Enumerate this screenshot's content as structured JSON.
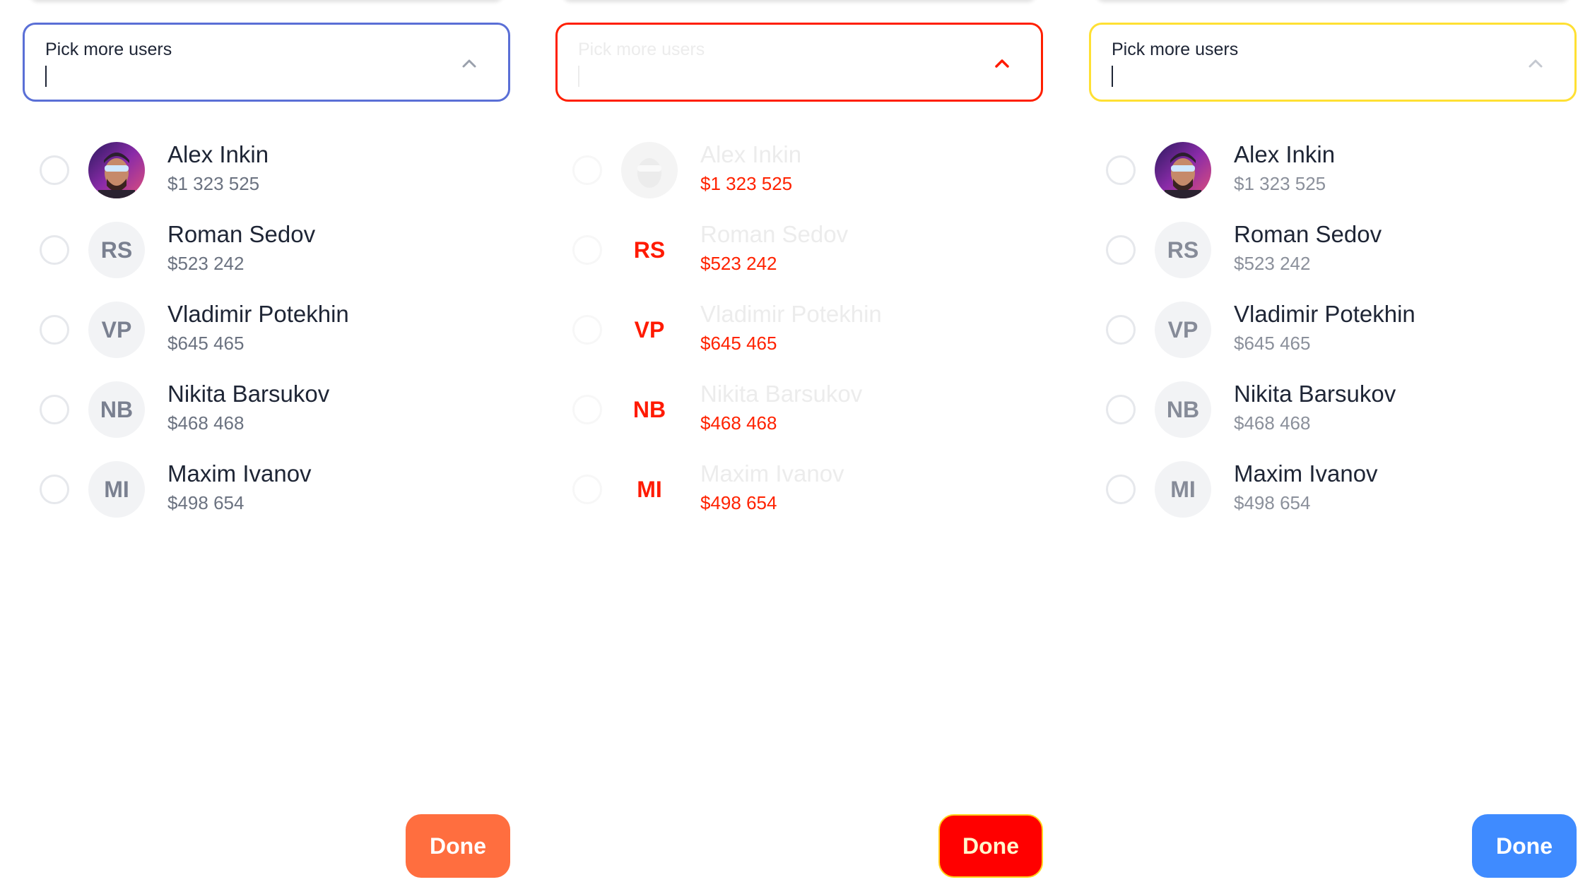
{
  "panels": [
    {
      "variant": "default",
      "field": {
        "label": "Pick more users"
      },
      "users": [
        {
          "name": "Alex Inkin",
          "amount": "$1 323 525",
          "initials": ""
        },
        {
          "name": "Roman Sedov",
          "amount": "$523 242",
          "initials": "RS"
        },
        {
          "name": "Vladimir Potekhin",
          "amount": "$645 465",
          "initials": "VP"
        },
        {
          "name": "Nikita Barsukov",
          "amount": "$468 468",
          "initials": "NB"
        },
        {
          "name": "Maxim Ivanov",
          "amount": "$498 654",
          "initials": "MI"
        }
      ],
      "done_label": "Done",
      "colors": {
        "border": "#5a6fd6",
        "done": "#ff6e3f"
      }
    },
    {
      "variant": "red",
      "field": {
        "label": "Pick more users"
      },
      "users": [
        {
          "name": "Alex Inkin",
          "amount": "$1 323 525",
          "initials": ""
        },
        {
          "name": "Roman Sedov",
          "amount": "$523 242",
          "initials": "RS"
        },
        {
          "name": "Vladimir Potekhin",
          "amount": "$645 465",
          "initials": "VP"
        },
        {
          "name": "Nikita Barsukov",
          "amount": "$468 468",
          "initials": "NB"
        },
        {
          "name": "Maxim Ivanov",
          "amount": "$498 654",
          "initials": "MI"
        }
      ],
      "done_label": "Done",
      "colors": {
        "border": "#ff1f00",
        "done": "#ff0000"
      }
    },
    {
      "variant": "yellow",
      "field": {
        "label": "Pick more users"
      },
      "users": [
        {
          "name": "Alex Inkin",
          "amount": "$1 323 525",
          "initials": ""
        },
        {
          "name": "Roman Sedov",
          "amount": "$523 242",
          "initials": "RS"
        },
        {
          "name": "Vladimir Potekhin",
          "amount": "$645 465",
          "initials": "VP"
        },
        {
          "name": "Nikita Barsukov",
          "amount": "$468 468",
          "initials": "NB"
        },
        {
          "name": "Maxim Ivanov",
          "amount": "$498 654",
          "initials": "MI"
        }
      ],
      "done_label": "Done",
      "colors": {
        "border": "#ffe033",
        "done": "#3f8bff"
      }
    }
  ]
}
